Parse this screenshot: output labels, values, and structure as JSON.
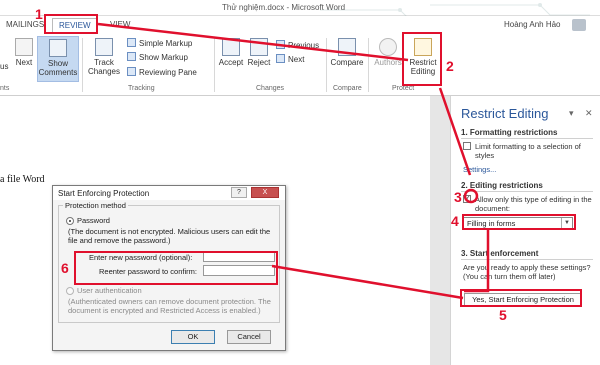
{
  "window": {
    "title": "Thử nghiệm.docx - Microsoft Word"
  },
  "tabs": {
    "mailings": "MAILINGS",
    "review": "REVIEW",
    "view": "VIEW"
  },
  "user": {
    "name": "Hoàng Anh Hảo"
  },
  "ribbon": {
    "previous_partial": "us",
    "next": "Next",
    "show_comments": "Show\nComments",
    "track_changes": "Track\nChanges",
    "simple_markup": "Simple Markup",
    "show_markup": "Show Markup",
    "reviewing_pane": "Reviewing Pane",
    "accept": "Accept",
    "reject": "Reject",
    "previous": "Previous",
    "next2": "Next",
    "compare": "Compare",
    "block_authors": "Authors",
    "restrict_editing": "Restrict\nEditing",
    "groups": {
      "comments_partial": "nts",
      "tracking": "Tracking",
      "changes": "Changes",
      "compare": "Compare",
      "protect": "Protect"
    }
  },
  "document": {
    "text": "a file Word"
  },
  "pane": {
    "title": "Restrict Editing",
    "section1": "1. Formatting restrictions",
    "limit_formatting": "Limit formatting to a selection of styles",
    "settings_link": "Settings...",
    "section2": "2. Editing restrictions",
    "allow_only": "Allow only this type of editing in the document:",
    "editing_type": "Filling in forms",
    "section3": "3. Start enforcement",
    "ready_text": "Are you ready to apply these settings? (You can turn them off later)",
    "enforce_button": "Yes, Start Enforcing Protection"
  },
  "dialog": {
    "title": "Start Enforcing Protection",
    "help": "?",
    "close": "X",
    "method_label": "Protection method",
    "password_option": "Password",
    "password_desc": "(The document is not encrypted. Malicious users can edit the file and remove the password.)",
    "new_password_label": "Enter new password (optional):",
    "reenter_label": "Reenter password to confirm:",
    "user_auth_option": "User authentication",
    "user_auth_desc": "(Authenticated owners can remove document protection. The document is encrypted and Restricted Access is enabled.)",
    "ok": "OK",
    "cancel": "Cancel"
  },
  "annotations": [
    "1",
    "2",
    "3",
    "4",
    "5",
    "6"
  ],
  "colors": {
    "annotation": "#e0102d",
    "accent": "#2b579a",
    "show_comments_bg": "#c5d9f1"
  }
}
